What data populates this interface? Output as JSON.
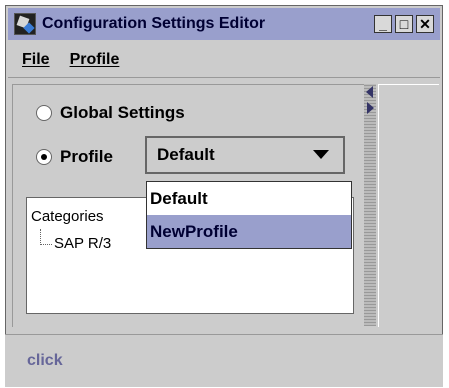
{
  "window": {
    "title": "Configuration Settings Editor",
    "controls": {
      "minimize": "_",
      "maximize": "□",
      "close": "✕"
    }
  },
  "menubar": {
    "items": [
      "File",
      "Profile"
    ]
  },
  "settings": {
    "global_label": "Global Settings",
    "profile_label": "Profile",
    "selected_radio": "profile"
  },
  "combo": {
    "value": "Default",
    "options": [
      "Default",
      "NewProfile"
    ],
    "highlighted": "NewProfile"
  },
  "tree": {
    "title": "Categories",
    "items": [
      "SAP R/3"
    ]
  },
  "status": {
    "text": "click"
  },
  "colors": {
    "accent": "#999fcc",
    "status_text": "#666699",
    "panel_bg": "#cccccc"
  }
}
